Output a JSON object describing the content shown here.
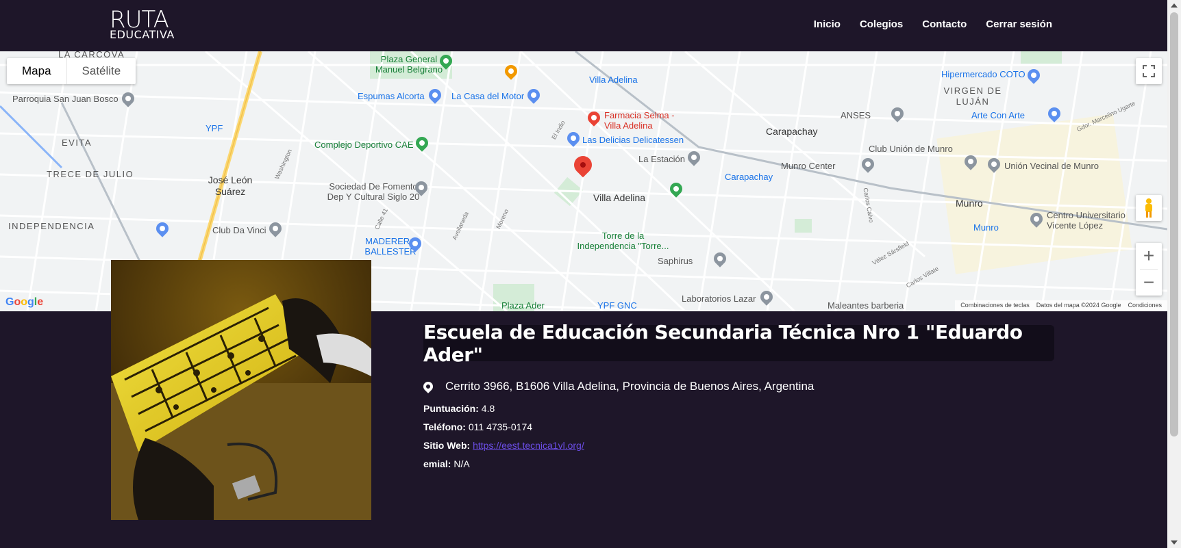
{
  "header": {
    "logo_line1": "RUTA",
    "logo_line2": "EDUCATIVA",
    "nav": [
      "Inicio",
      "Colegios",
      "Contacto",
      "Cerrar sesión"
    ]
  },
  "map": {
    "type_buttons": {
      "map": "Mapa",
      "satellite": "Satélite"
    },
    "google_logo": "Google",
    "attribution": [
      "Combinaciones de teclas",
      "Datos del mapa ©2024 Google",
      "Condiciones"
    ],
    "places": {
      "la_carcova": "LA CARCOVA",
      "plaza_belgrano": "Plaza General Manuel Belgrano",
      "villa_adelina_station": "Villa Adelina",
      "hipermercado": "Hipermercado COTO",
      "parroquia": "Parroquia San Juan Bosco",
      "espumas": "Espumas Alcorta",
      "casa_motor": "La Casa del Motor",
      "virgen_lujan": "VIRGEN DE LUJÁN",
      "farmacia": "Farmacia Selma - Villa Adelina",
      "anses": "ANSES",
      "arte_con_arte": "Arte Con Arte",
      "ypf": "YPF",
      "carapachay": "Carapachay",
      "evita": "EVITA",
      "complejo": "Complejo Deportivo CAE",
      "delicias": "Las Delicias Delicatessen",
      "club_munro": "Club Unión de Munro",
      "la_estacion": "La Estación",
      "munro_center": "Munro Center",
      "union_vecinal": "Unión Vecinal de Munro",
      "trece_julio": "TRECE DE JULIO",
      "jose_leon": "José León Suárez",
      "sociedad": "Sociedad De Fomento Dep Y Cultural Siglo 20",
      "villa_adelina": "Villa Adelina",
      "carapachay_station": "Carapachay",
      "munro": "Munro",
      "independencia": "INDEPENDENCIA",
      "club_da_vinci": "Club Da Vinci",
      "madera": "MADERERA BALLESTER",
      "torre": "Torre de la Independencia \"Torre...",
      "munro_station": "Munro",
      "centro_univ": "Centro Universitario Vicente López",
      "saphirus": "Saphirus",
      "plaza_ader": "Plaza Ader",
      "ypf_gnc": "YPF GNC",
      "laboratorios": "Laboratorios Lazar",
      "maleantes": "Maleantes barberia",
      "washington": "Washington",
      "calle41": "Calle 41",
      "moreno": "Moreno",
      "avellaneda": "Avellaneda",
      "carlos_calvo": "Carlos Calvo",
      "velez": "Vélez Sársfield",
      "carlos_villate": "Carlos Villate",
      "el_indio": "El Indio",
      "gdor_ugarte": "Gdor. Marcelino Ugarte"
    }
  },
  "school": {
    "name": "Escuela de Educación Secundaria Técnica Nro 1 \"Eduardo Ader\"",
    "address": "Cerrito 3966, B1606 Villa Adelina, Provincia de Buenos Aires, Argentina",
    "rating_label": "Puntuación:",
    "rating_value": "4.8",
    "phone_label": "Teléfono:",
    "phone_value": "011 4735-0174",
    "web_label": "Sitio Web:",
    "web_value": "https://eest.tecnica1vl.org/",
    "email_label": "emial:",
    "email_value": "N/A"
  },
  "colors": {
    "background": "#1e1629",
    "title_box": "#120d1a",
    "link": "#6b4de6",
    "marker_red": "#ea4335"
  }
}
